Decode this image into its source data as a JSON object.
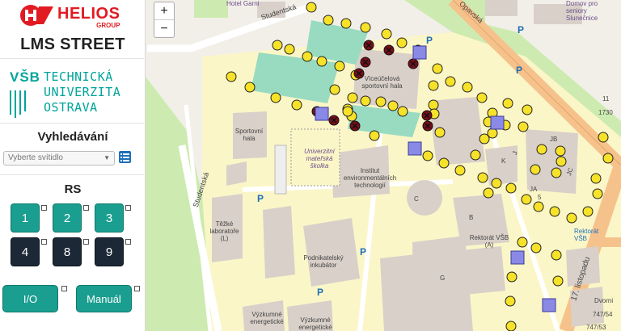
{
  "sidebar": {
    "brand": {
      "name": "HELIOS",
      "group": "GROUP"
    },
    "app_title": "LMS STREET",
    "university": {
      "abbr": "VŠB",
      "line1": "TECHNICKÁ",
      "line2": "UNIVERZITA",
      "line3": "OSTRAVA"
    },
    "search_title": "Vyhledávání",
    "select_placeholder": "Vyberte svítidlo",
    "rs_title": "RS",
    "buttons": [
      "1",
      "2",
      "3",
      "4",
      "8",
      "9"
    ],
    "io_label": "I/O",
    "manual_label": "Manuál"
  },
  "map": {
    "zoom_in": "+",
    "zoom_out": "−",
    "labels": {
      "street_top": "Studentská",
      "street_left": "Studentská",
      "hotel": "Hotel Garni",
      "opavska": "Opavská",
      "senior": "Domov pro seniory Slunečnice",
      "sportovni_hala": "Sportovní hala",
      "vicesportovni": "Víceúčelová sportovní hala",
      "skolka": "Univerzitní mateřská školka",
      "institut": "Institut environmentálních technologií",
      "tezke": "Těžké laboratoře (L)",
      "podnikatelsky": "Podnikatelský inkubátor",
      "rektorat": "Rektorát VŠB (A)",
      "vyzkumne1": "Výzkumné energetické",
      "vyzkumne2": "Výzkumné energetické",
      "listopadu": "17. listopadu",
      "vsb_stop": "Rektorát VŠB",
      "dvorni": "Dvorni",
      "b_g": "G",
      "b_c": "C",
      "b_b": "B",
      "b_k": "K",
      "b_jb": "JB",
      "b_jc": "JC",
      "b_ja": "JA",
      "b_j": "J",
      "hn_11": "11",
      "hn_1730": "1730",
      "hn_747_54": "747/54",
      "hn_747_53": "747/53",
      "hn_5": "5",
      "parking": "P"
    }
  },
  "colors": {
    "teal": "#1a9e8f",
    "dark": "#1c2836",
    "helios_red": "#e21b22",
    "vsb_teal": "#00a499",
    "lamp": "#f7e22a",
    "map_bg": "#f2efe9"
  }
}
